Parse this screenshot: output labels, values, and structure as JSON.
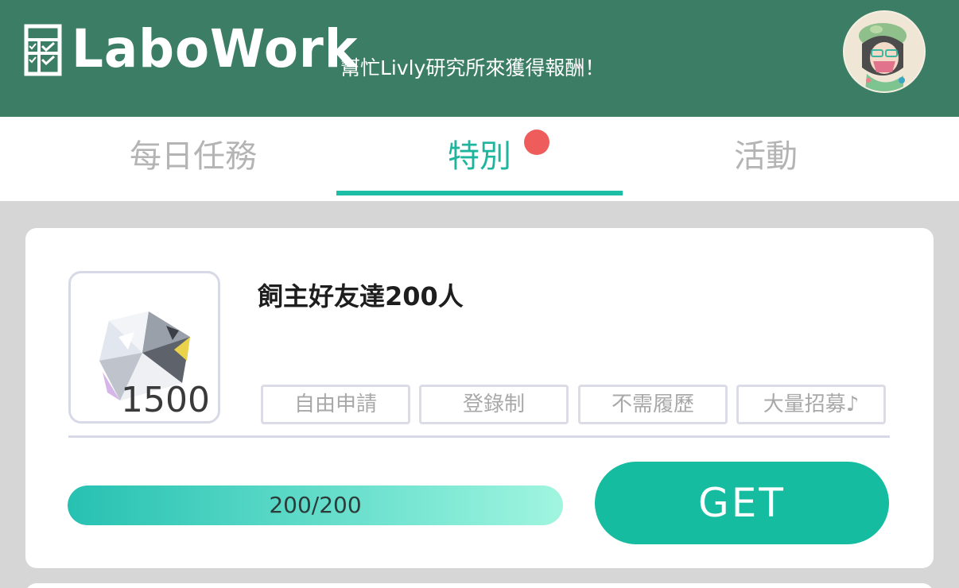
{
  "header": {
    "logo_text": "LaboWork",
    "tagline": "幫忙Livly研究所來獲得報酬！",
    "logo_icon": "checklist-icon",
    "avatar_icon": "user-avatar"
  },
  "tabs": [
    {
      "label": "每日任務",
      "active": false
    },
    {
      "label": "特別",
      "active": true,
      "has_notification": true
    },
    {
      "label": "活動",
      "active": false
    }
  ],
  "task": {
    "title": "飼主好友達200人",
    "reward_icon": "diamond-icon",
    "reward_amount": "1500",
    "tags": [
      "自由申請",
      "登錄制",
      "不需履歷",
      "大量招募♪"
    ],
    "progress_text": "200/200",
    "progress_fraction": 1.0,
    "button_label": "GET"
  },
  "colors": {
    "header_bg": "#3c7d66",
    "accent": "#1cbfa6",
    "notification": "#ee5c5c",
    "button": "#15bca0"
  }
}
